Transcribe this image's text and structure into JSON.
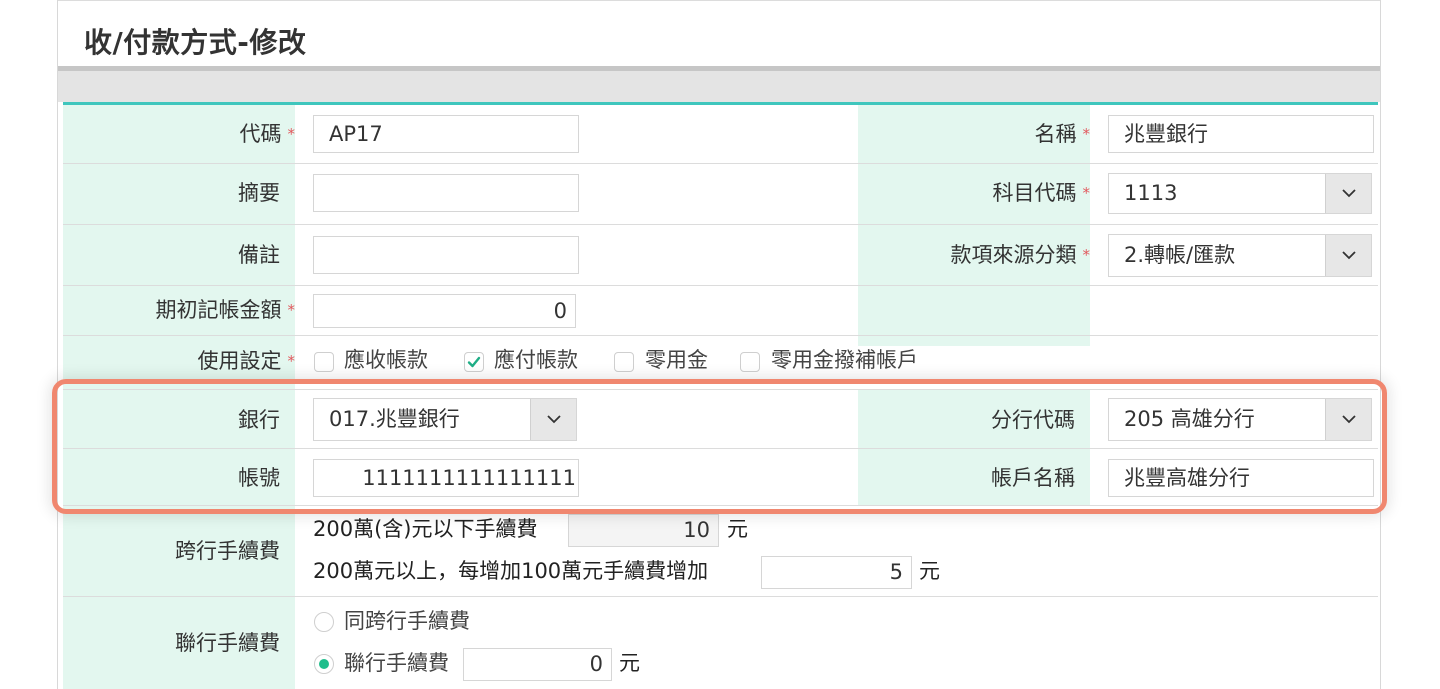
{
  "header": {
    "title": "收/付款方式-修改"
  },
  "required_marker": "*",
  "form": {
    "code": {
      "label": "代碼",
      "value": "AP17"
    },
    "name": {
      "label": "名稱",
      "value": "兆豐銀行"
    },
    "summary": {
      "label": "摘要",
      "value": ""
    },
    "subject_code": {
      "label": "科目代碼",
      "value": "1113"
    },
    "remark": {
      "label": "備註",
      "value": ""
    },
    "source_category": {
      "label": "款項來源分類",
      "value": "2.轉帳/匯款"
    },
    "opening_amount": {
      "label": "期初記帳金額",
      "value": "0"
    },
    "usage": {
      "label": "使用設定",
      "options": [
        {
          "label": "應收帳款",
          "checked": false
        },
        {
          "label": "應付帳款",
          "checked": true
        },
        {
          "label": "零用金",
          "checked": false
        },
        {
          "label": "零用金撥補帳戶",
          "checked": false
        }
      ]
    },
    "bank": {
      "label": "銀行",
      "value": "017.兆豐銀行"
    },
    "branch_code": {
      "label": "分行代碼",
      "value": "205 高雄分行"
    },
    "account_no": {
      "label": "帳號",
      "value": "1111111111111111"
    },
    "account_name": {
      "label": "帳戶名稱",
      "value": "兆豐高雄分行"
    },
    "interbank_fee": {
      "label": "跨行手續費",
      "line1_text": "200萬(含)元以下手續費",
      "line1_value": "10",
      "line2_text": "200萬元以上，每增加100萬元手續費增加",
      "line2_value": "5",
      "unit": "元"
    },
    "joint_fee": {
      "label": "聯行手續費",
      "option_same": "同跨行手續費",
      "option_custom": "聯行手續費",
      "selected": "option_custom",
      "value": "0",
      "unit": "元"
    }
  },
  "colors": {
    "label_bg": "#e3f7ef",
    "accent_teal": "#3fc6bd",
    "required": "#e2595e",
    "highlight_border": "#f0876f",
    "radio_on": "#1fbe8c",
    "check_mark": "#1fae86"
  }
}
